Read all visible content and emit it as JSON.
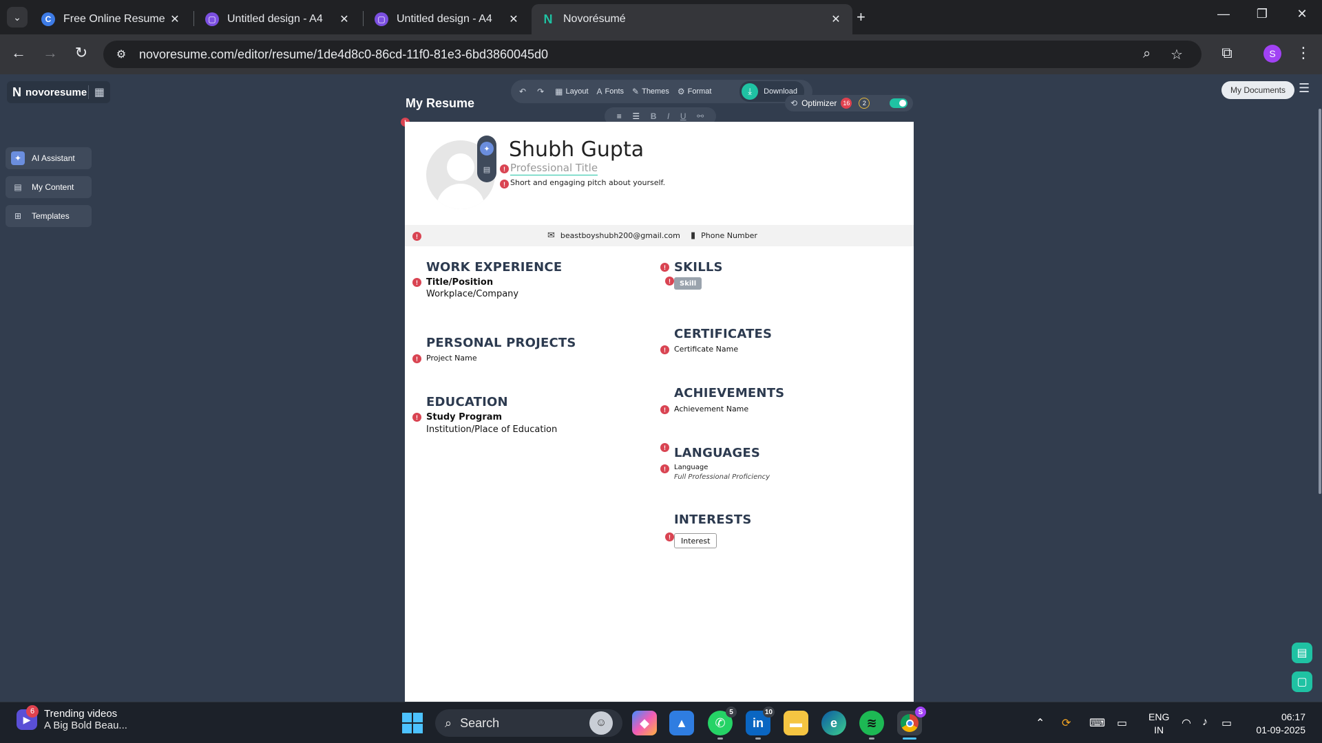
{
  "browser": {
    "tabs": [
      {
        "title": "Free Online Resume Builder | Ea",
        "favicon": "canva-icon",
        "color": "#3d7be6",
        "active": false
      },
      {
        "title": "Untitled design - A4",
        "favicon": "canva-design-icon",
        "color": "#7b4fe0",
        "active": false
      },
      {
        "title": "Untitled design - A4",
        "favicon": "canva-design-icon",
        "color": "#7b4fe0",
        "active": false
      },
      {
        "title": "Novorésumé",
        "favicon": "novoresume-icon",
        "color": "#1fc2a3",
        "active": true
      }
    ],
    "url": "novoresume.com/editor/resume/1de4d8c0-86cd-11f0-81e3-6bd3860045d0",
    "profile_initial": "S"
  },
  "app": {
    "logo_text": "novoresume",
    "sidebar": [
      {
        "label": "AI Assistant",
        "icon": "ai-assistant-icon"
      },
      {
        "label": "My Content",
        "icon": "my-content-icon"
      },
      {
        "label": "Templates",
        "icon": "templates-icon"
      }
    ],
    "toolbar": {
      "layout": "Layout",
      "fonts": "Fonts",
      "themes": "Themes",
      "format": "Format",
      "download": "Download"
    },
    "page_title": "My Resume",
    "optimizer": {
      "label": "Optimizer",
      "errors": "16",
      "warnings": "2",
      "enabled": true
    },
    "my_documents": "My Documents",
    "accent_color": "#1fc2a3",
    "error_color": "#d94452"
  },
  "resume": {
    "name": "Shubh Gupta",
    "professional_title": "Professional Title",
    "pitch": "Short and engaging pitch about yourself.",
    "email": "beastboyshubh200@gmail.com",
    "phone": "Phone Number",
    "sections": {
      "work_experience": {
        "heading": "WORK EXPERIENCE",
        "title": "Title/Position",
        "company": "Workplace/Company"
      },
      "personal_projects": {
        "heading": "PERSONAL PROJECTS",
        "name": "Project Name"
      },
      "education": {
        "heading": "EDUCATION",
        "program": "Study Program",
        "institution": "Institution/Place of Education"
      },
      "skills": {
        "heading": "SKILLS",
        "skill": "Skill"
      },
      "certificates": {
        "heading": "CERTIFICATES",
        "name": "Certificate Name"
      },
      "achievements": {
        "heading": "ACHIEVEMENTS",
        "name": "Achievement Name"
      },
      "languages": {
        "heading": "LANGUAGES",
        "language": "Language",
        "proficiency": "Full Professional Proficiency"
      },
      "interests": {
        "heading": "INTERESTS",
        "interest": "Interest"
      }
    }
  },
  "taskbar": {
    "widget": {
      "badge": "6",
      "title": "Trending videos",
      "subtitle": "A Big Bold Beau..."
    },
    "search_placeholder": "Search",
    "apps": [
      {
        "name": "copilot-icon",
        "badge": ""
      },
      {
        "name": "photos-icon",
        "badge": ""
      },
      {
        "name": "whatsapp-icon",
        "badge": "5"
      },
      {
        "name": "linkedin-icon",
        "badge": "10"
      },
      {
        "name": "file-explorer-icon",
        "badge": ""
      },
      {
        "name": "edge-icon",
        "badge": ""
      },
      {
        "name": "spotify-icon",
        "badge": ""
      },
      {
        "name": "chrome-icon",
        "badge": "S"
      }
    ],
    "lang_line1": "ENG",
    "lang_line2": "IN",
    "time": "06:17",
    "date": "01-09-2025"
  }
}
